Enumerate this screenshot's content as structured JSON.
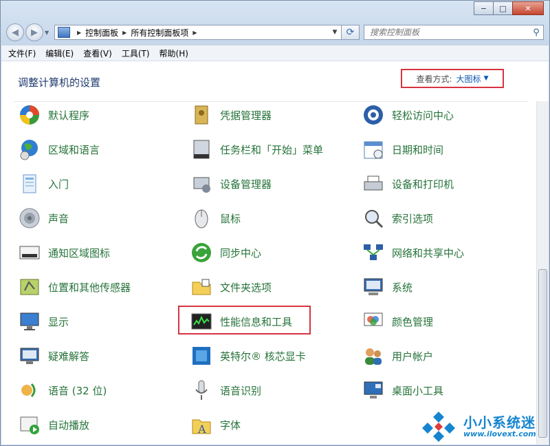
{
  "window": {
    "minimize": "−",
    "maximize": "□",
    "close": "✕"
  },
  "address": {
    "crumbs": [
      "控制面板",
      "所有控制面板项"
    ]
  },
  "search": {
    "placeholder": "搜索控制面板"
  },
  "menu": [
    "文件(F)",
    "编辑(E)",
    "查看(V)",
    "工具(T)",
    "帮助(H)"
  ],
  "header": {
    "title": "调整计算机的设置",
    "view_label": "查看方式:",
    "view_value": "大图标"
  },
  "columns": [
    [
      {
        "label": "默认程序",
        "icon": "default-programs-icon"
      },
      {
        "label": "区域和语言",
        "icon": "region-language-icon"
      },
      {
        "label": "入门",
        "icon": "getting-started-icon"
      },
      {
        "label": "声音",
        "icon": "sound-icon"
      },
      {
        "label": "通知区域图标",
        "icon": "notification-area-icon"
      },
      {
        "label": "位置和其他传感器",
        "icon": "location-sensors-icon"
      },
      {
        "label": "显示",
        "icon": "display-icon"
      },
      {
        "label": "疑难解答",
        "icon": "troubleshooting-icon"
      },
      {
        "label": "语音 (32 位)",
        "icon": "speech-32bit-icon"
      },
      {
        "label": "自动播放",
        "icon": "autoplay-icon"
      }
    ],
    [
      {
        "label": "凭据管理器",
        "icon": "credential-manager-icon"
      },
      {
        "label": "任务栏和「开始」菜单",
        "icon": "taskbar-start-menu-icon"
      },
      {
        "label": "设备管理器",
        "icon": "device-manager-icon"
      },
      {
        "label": "鼠标",
        "icon": "mouse-icon"
      },
      {
        "label": "同步中心",
        "icon": "sync-center-icon"
      },
      {
        "label": "文件夹选项",
        "icon": "folder-options-icon"
      },
      {
        "label": "性能信息和工具",
        "icon": "performance-info-icon"
      },
      {
        "label": "英特尔® 核芯显卡",
        "icon": "intel-graphics-icon"
      },
      {
        "label": "语音识别",
        "icon": "speech-recognition-icon"
      },
      {
        "label": "字体",
        "icon": "fonts-icon"
      }
    ],
    [
      {
        "label": "轻松访问中心",
        "icon": "ease-of-access-icon"
      },
      {
        "label": "日期和时间",
        "icon": "date-time-icon"
      },
      {
        "label": "设备和打印机",
        "icon": "devices-printers-icon"
      },
      {
        "label": "索引选项",
        "icon": "indexing-options-icon"
      },
      {
        "label": "网络和共享中心",
        "icon": "network-sharing-icon"
      },
      {
        "label": "系统",
        "icon": "system-icon"
      },
      {
        "label": "颜色管理",
        "icon": "color-management-icon"
      },
      {
        "label": "用户帐户",
        "icon": "user-accounts-icon"
      },
      {
        "label": "桌面小工具",
        "icon": "desktop-gadgets-icon"
      }
    ]
  ],
  "watermark": {
    "title": "小小系统迷",
    "url": "www.ilovext.com"
  }
}
